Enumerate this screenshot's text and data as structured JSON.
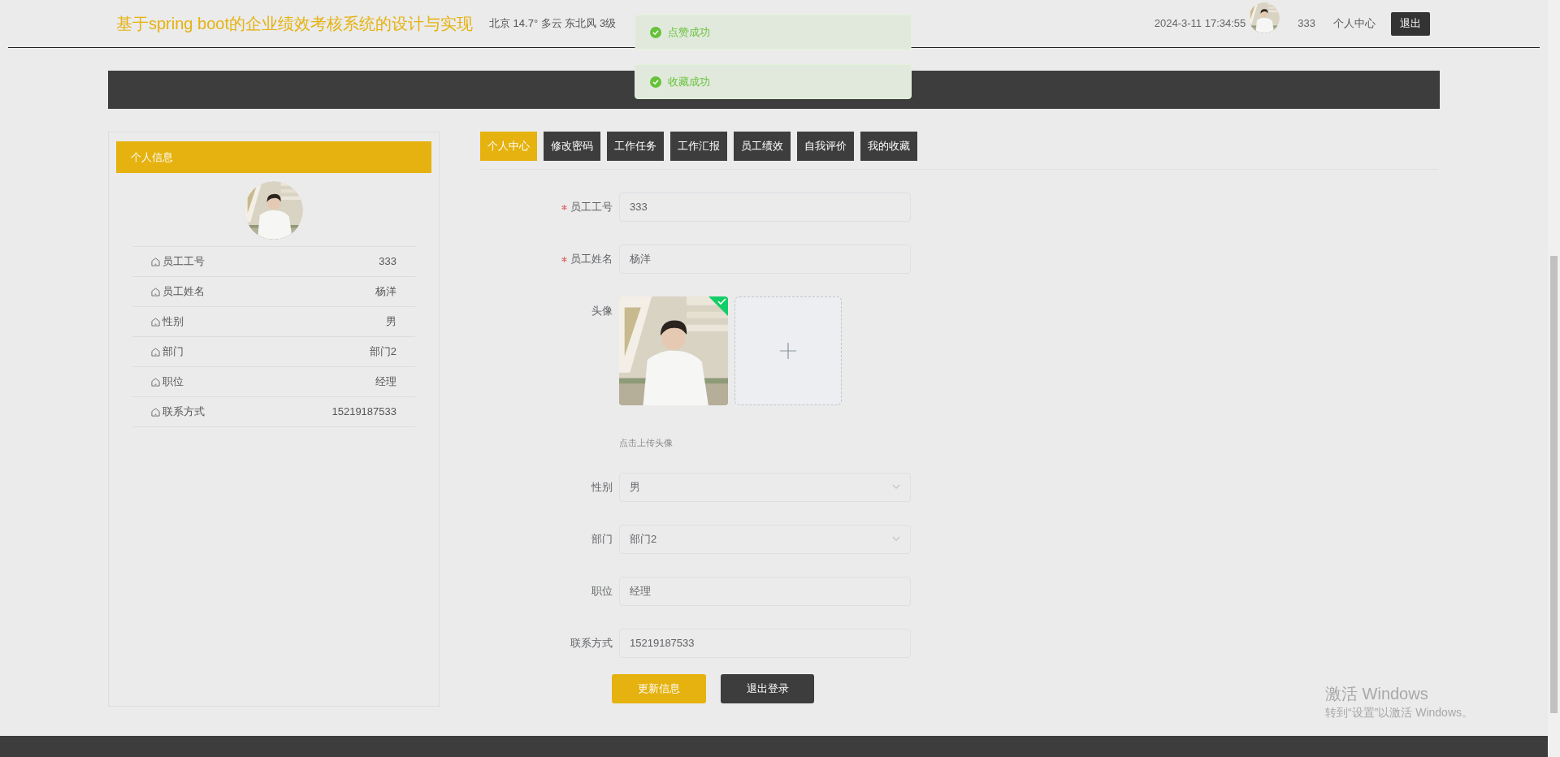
{
  "header": {
    "title": "基于spring boot的企业绩效考核系统的设计与实现",
    "weather": "北京 14.7° 多云 东北风 3级",
    "datetime": "2024-3-11 17:34:55",
    "username": "333",
    "profile_link": "个人中心",
    "logout_button": "退出"
  },
  "toasts": [
    {
      "text": "点赞成功"
    },
    {
      "text": "收藏成功"
    }
  ],
  "sidebar": {
    "title": "个人信息",
    "rows": [
      {
        "label": "员工工号",
        "value": "333"
      },
      {
        "label": "员工姓名",
        "value": "杨洋"
      },
      {
        "label": "性别",
        "value": "男"
      },
      {
        "label": "部门",
        "value": "部门2"
      },
      {
        "label": "职位",
        "value": "经理"
      },
      {
        "label": "联系方式",
        "value": "15219187533"
      }
    ]
  },
  "tabs": [
    {
      "label": "个人中心",
      "selected": true
    },
    {
      "label": "修改密码",
      "selected": false
    },
    {
      "label": "工作任务",
      "selected": false
    },
    {
      "label": "工作汇报",
      "selected": false
    },
    {
      "label": "员工绩效",
      "selected": false
    },
    {
      "label": "自我评价",
      "selected": false
    },
    {
      "label": "我的收藏",
      "selected": false
    }
  ],
  "form": {
    "fields": [
      {
        "kind": "input",
        "label": "员工工号",
        "required": true,
        "value": "333"
      },
      {
        "kind": "input",
        "label": "员工姓名",
        "required": true,
        "value": "杨洋"
      },
      {
        "kind": "upload",
        "label": "头像",
        "required": false,
        "hint": "点击上传头像"
      },
      {
        "kind": "select",
        "label": "性别",
        "required": false,
        "value": "男"
      },
      {
        "kind": "select",
        "label": "部门",
        "required": false,
        "value": "部门2"
      },
      {
        "kind": "input",
        "label": "职位",
        "required": false,
        "value": "经理"
      },
      {
        "kind": "input",
        "label": "联系方式",
        "required": false,
        "value": "15219187533"
      }
    ],
    "buttons": [
      {
        "kind": "primary",
        "label": "更新信息"
      },
      {
        "kind": "dark",
        "label": "退出登录"
      }
    ]
  },
  "os_watermark": {
    "title": "激活 Windows",
    "subtitle": "转到“设置”以激活 Windows。"
  }
}
